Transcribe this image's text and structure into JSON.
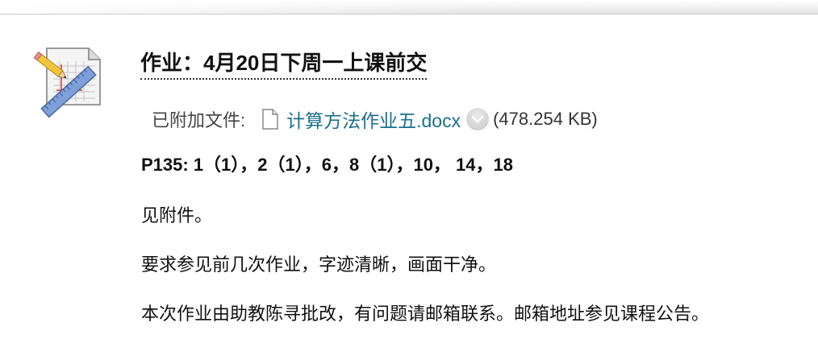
{
  "assignment": {
    "title": "作业：4月20日下周一上课前交"
  },
  "attachment": {
    "label": "已附加文件:",
    "file_name": "计算方法作业五.docx",
    "file_size": "(478.254 KB)"
  },
  "content": {
    "line_1": "P135: 1（1），2（1），6，8（1），10， 14，18",
    "line_2": "见附件。",
    "line_3": "要求参见前几次作业，字迹清晰，画面干净。",
    "line_4": "本次作业由助教陈寻批改，有问题请邮箱联系。邮箱地址参见课程公告。"
  },
  "icons": {
    "assignment": "assignment-pencil-ruler-icon",
    "file": "document-file-icon",
    "dropdown": "chevron-down-icon"
  },
  "colors": {
    "link": "#1a6f8e",
    "text": "#111111",
    "label": "#444444"
  }
}
